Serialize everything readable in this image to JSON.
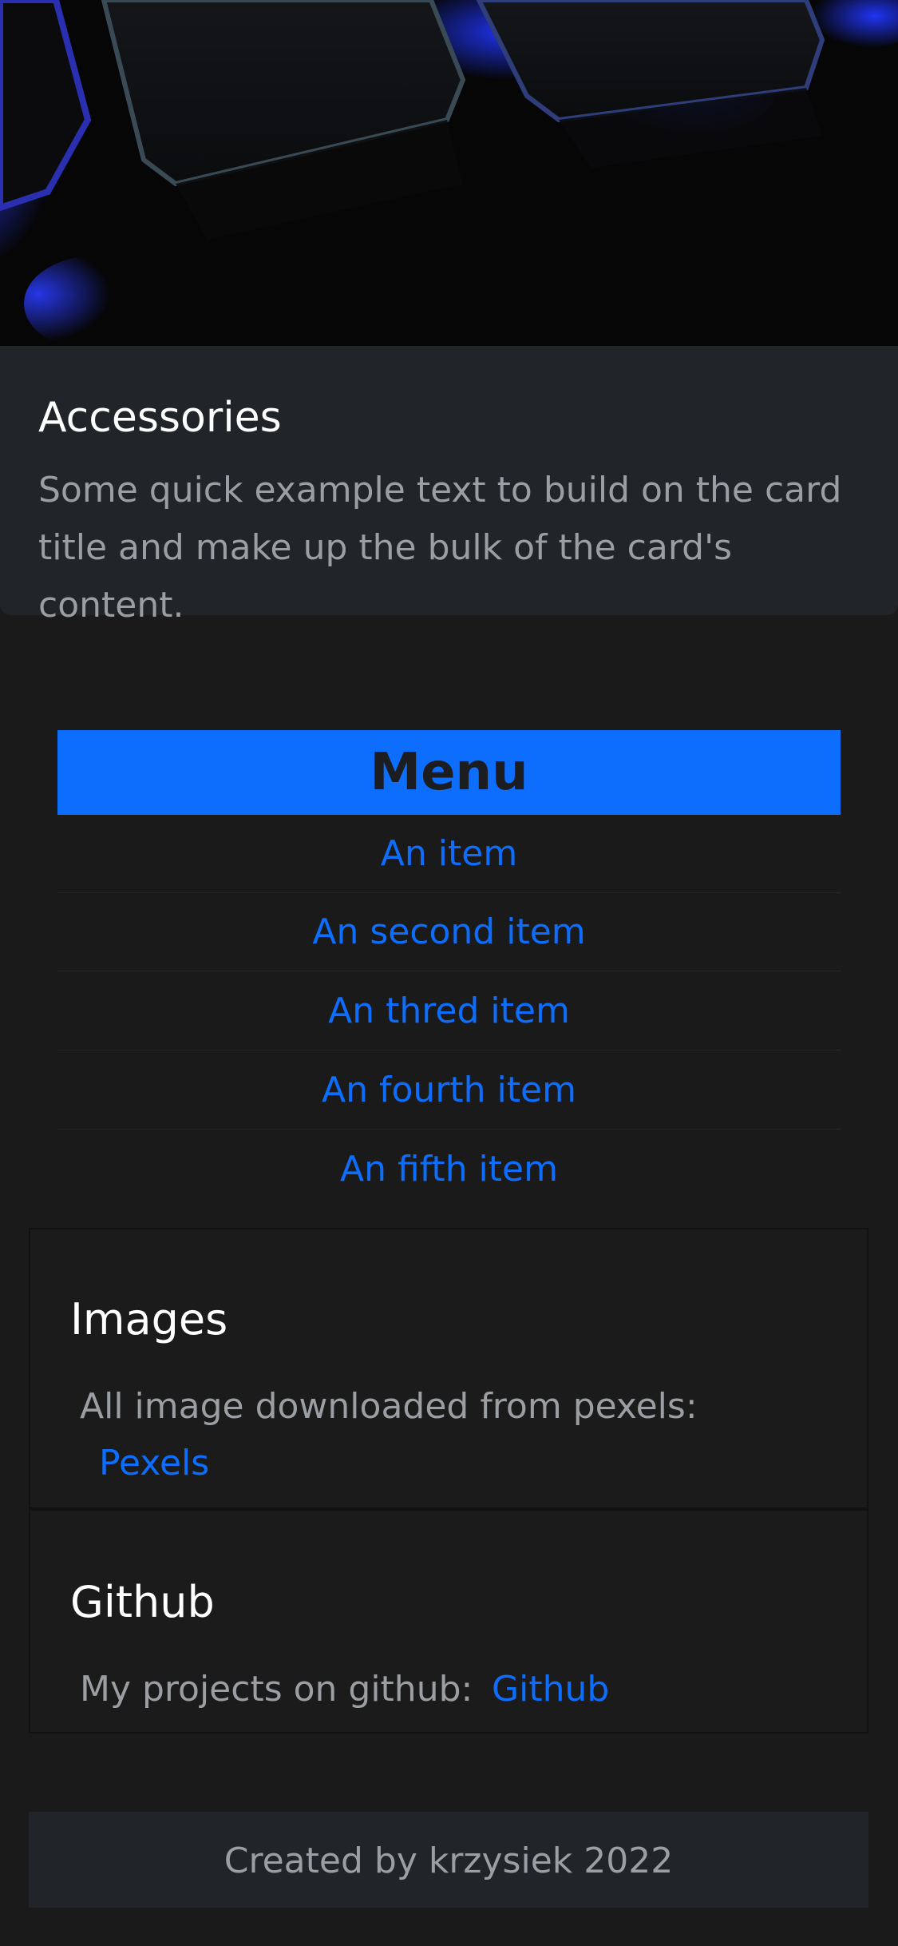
{
  "card": {
    "title": "Accessories",
    "text": "Some quick example text to build on the card title and make up the bulk of the card's content."
  },
  "menu": {
    "title": "Menu",
    "items": [
      {
        "label": "An item"
      },
      {
        "label": "An second item"
      },
      {
        "label": "An thred item"
      },
      {
        "label": "An fourth item"
      },
      {
        "label": "An fifth item"
      }
    ]
  },
  "images_section": {
    "title": "Images",
    "text": "All image downloaded from pexels:",
    "link": "Pexels"
  },
  "github_section": {
    "title": "Github",
    "text": "My projects on github:",
    "link": "Github"
  },
  "footer": {
    "text": "Created by krzysiek 2022"
  },
  "colors": {
    "accent": "#0d6efd",
    "background": "#1a1a1b",
    "card_background": "#212429",
    "muted_text": "#9b9ea3"
  }
}
